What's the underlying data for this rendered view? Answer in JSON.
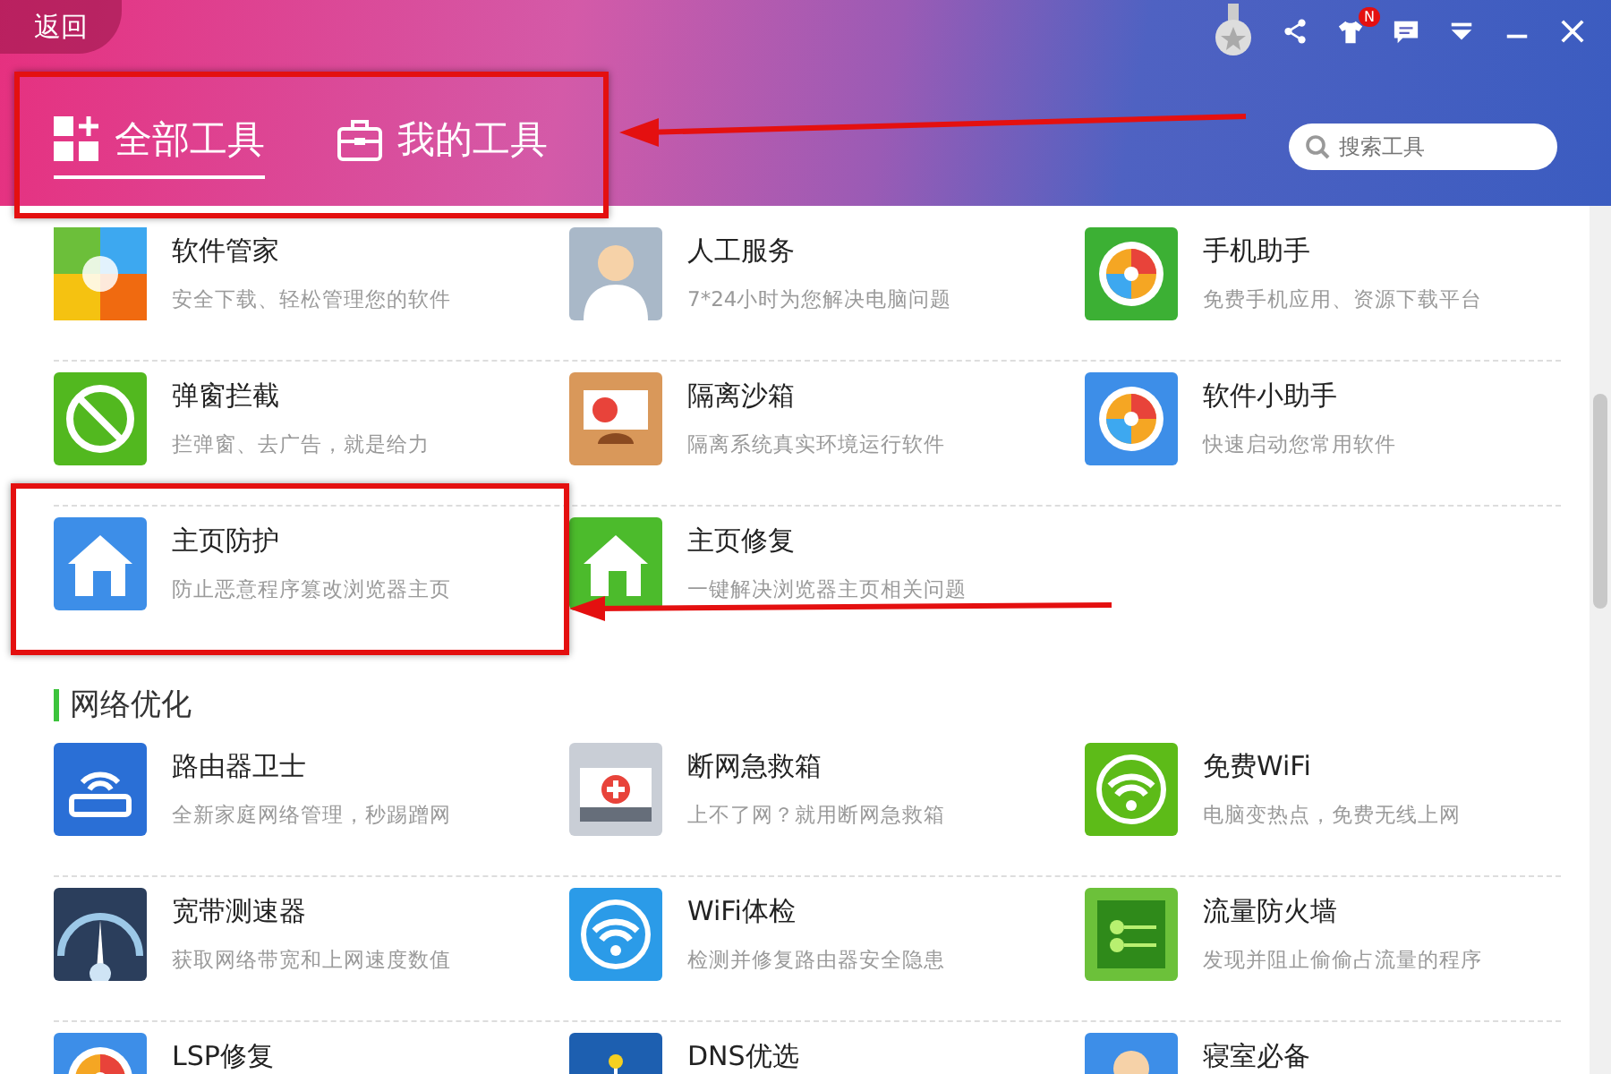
{
  "window": {
    "back": "返回",
    "badge": "N"
  },
  "tabs": [
    {
      "label": "全部工具",
      "selected": true
    },
    {
      "label": "我的工具",
      "selected": false
    }
  ],
  "search": {
    "placeholder": "搜索工具"
  },
  "sections": [
    {
      "items": [
        {
          "name": "软件管家",
          "desc": "安全下载、轻松管理您的软件"
        },
        {
          "name": "人工服务",
          "desc": "7*24小时为您解决电脑问题"
        },
        {
          "name": "手机助手",
          "desc": "免费手机应用、资源下载平台"
        },
        {
          "name": "弹窗拦截",
          "desc": "拦弹窗、去广告，就是给力"
        },
        {
          "name": "隔离沙箱",
          "desc": "隔离系统真实环境运行软件"
        },
        {
          "name": "软件小助手",
          "desc": "快速启动您常用软件"
        },
        {
          "name": "主页防护",
          "desc": "防止恶意程序篡改浏览器主页"
        },
        {
          "name": "主页修复",
          "desc": "一键解决浏览器主页相关问题"
        }
      ]
    },
    {
      "title": "网络优化",
      "items": [
        {
          "name": "路由器卫士",
          "desc": "全新家庭网络管理，秒踢蹭网"
        },
        {
          "name": "断网急救箱",
          "desc": "上不了网？就用断网急救箱"
        },
        {
          "name": "免费WiFi",
          "desc": "电脑变热点，免费无线上网"
        },
        {
          "name": "宽带测速器",
          "desc": "获取网络带宽和上网速度数值"
        },
        {
          "name": "WiFi体检",
          "desc": "检测并修复路由器安全隐患"
        },
        {
          "name": "流量防火墙",
          "desc": "发现并阻止偷偷占流量的程序"
        },
        {
          "name": "LSP修复"
        },
        {
          "name": "DNS优选"
        },
        {
          "name": "寝室必备"
        }
      ]
    }
  ]
}
